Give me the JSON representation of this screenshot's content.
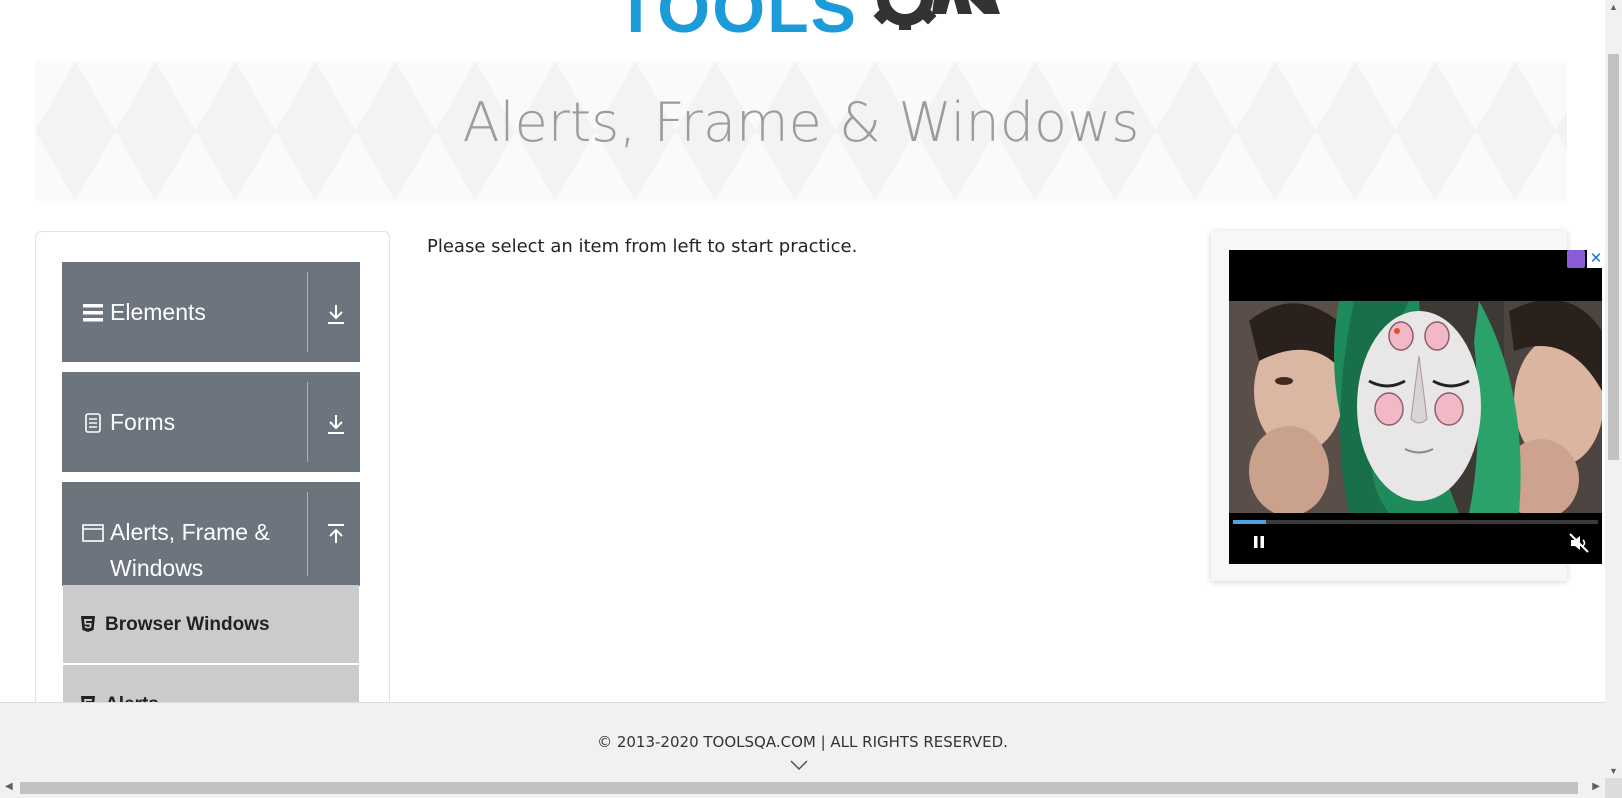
{
  "brand": {
    "logo_text": "TOOLSQA",
    "logo_visible_text": "TOOLS"
  },
  "banner": {
    "title": "Alerts, Frame & Windows"
  },
  "sidebar": {
    "groups": [
      {
        "label": "Elements",
        "icon": "hamburger-icon",
        "arrow": "download-arrow-icon"
      },
      {
        "label": "Forms",
        "icon": "document-icon",
        "arrow": "download-arrow-icon"
      },
      {
        "label": "Alerts, Frame & Windows",
        "icon": "window-icon",
        "arrow": "upload-arrow-icon"
      }
    ],
    "submenu": [
      {
        "label": "Browser Windows",
        "icon": "html5-icon"
      },
      {
        "label": "Alerts",
        "icon": "html5-icon"
      }
    ]
  },
  "main": {
    "message": "Please select an item from left to start practice."
  },
  "ad": {
    "progress_fraction": 0.09,
    "close_label": "✕"
  },
  "footer": {
    "copyright": "© 2013-2020 TOOLSQA.COM | ALL RIGHTS RESERVED."
  },
  "colors": {
    "header_gray": "#6c757d",
    "submenu_gray": "#cbcbcb",
    "brand_blue": "#1b9bd7",
    "title_gray": "#9c9c9c"
  }
}
